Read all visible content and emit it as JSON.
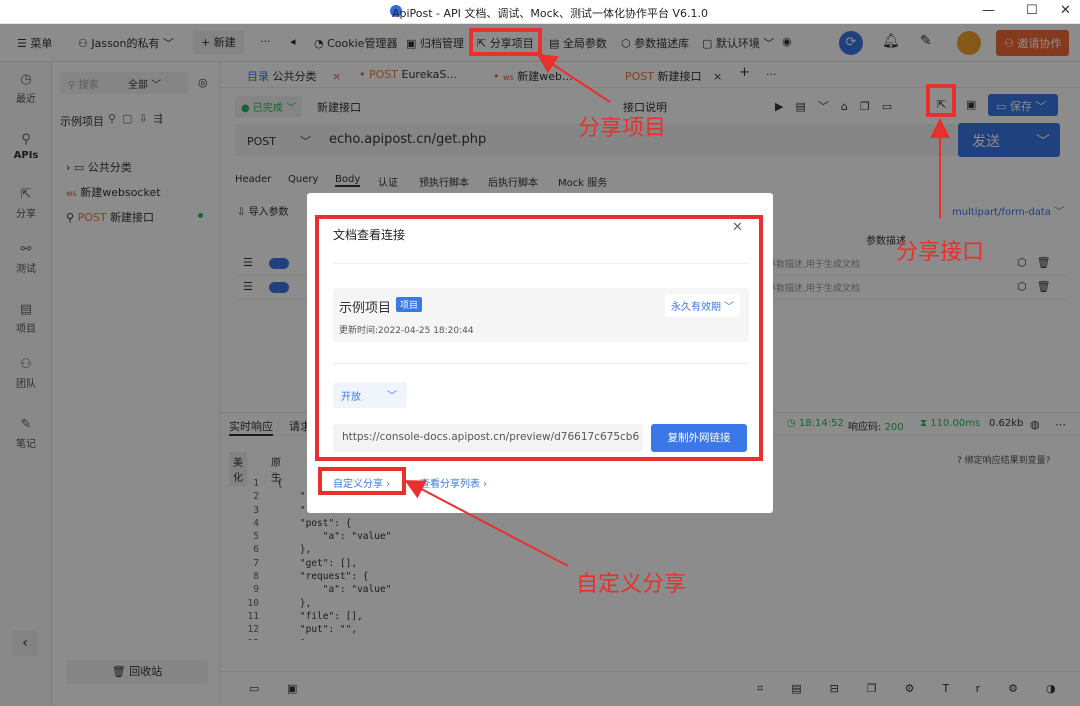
{
  "window": {
    "title": "ApiPost - API 文档、调试、Mock、测试一体化协作平台 V6.1.0"
  },
  "topbar": {
    "menu": "菜单",
    "workspace": "Jasson的私有",
    "new": "新建",
    "more": "···",
    "cookie": "Cookie管理器",
    "archive": "归档管理",
    "share_project": "分享项目",
    "global_params": "全局参数",
    "param_desc": "参数描述库",
    "env": "默认环境",
    "invite": "邀请协作"
  },
  "sidebar": {
    "items": [
      {
        "label": "最近"
      },
      {
        "label": "APIs"
      },
      {
        "label": "分享"
      },
      {
        "label": "测试"
      },
      {
        "label": "项目"
      },
      {
        "label": "团队"
      },
      {
        "label": "笔记"
      }
    ]
  },
  "tree": {
    "search_placeholder": "搜索",
    "filter": "全部",
    "project": "示例项目",
    "items": [
      {
        "label": "公共分类"
      },
      {
        "prefix": "ws",
        "label": "新建websocket"
      },
      {
        "prefix": "POST",
        "label": "新建接口"
      }
    ],
    "recycle": "回收站"
  },
  "tabs": [
    {
      "prefix": "目录",
      "label": "公共分类"
    },
    {
      "prefix": "POST",
      "label": "EurekaS..."
    },
    {
      "prefix": "ws",
      "label": "新建web..."
    },
    {
      "prefix": "POST",
      "label": "新建接口"
    }
  ],
  "request": {
    "status": "已完成",
    "name": "新建接口",
    "desc_label": "接口说明",
    "save": "保存",
    "method": "POST",
    "url": "echo.apipost.cn/get.php",
    "send": "发送"
  },
  "req_tabs": [
    "Header",
    "Query",
    "Body",
    "认证",
    "预执行脚本",
    "后执行脚本",
    "Mock 服务"
  ],
  "body": {
    "import": "导入参数",
    "content_type": "multipart/form-data",
    "param_desc_col": "参数描述",
    "row_hint": "参数描述,用于生成文档"
  },
  "response": {
    "tab_live": "实时响应",
    "tab_req": "请求",
    "beautify": "美化",
    "raw": "原生",
    "time": "18:14:52",
    "code_label": "响应码:",
    "code": "200",
    "duration": "110.00ms",
    "size": "0.62kb",
    "bind": "绑定响应结果到变量?",
    "lines": [
      "{",
      "    \"",
      "    \"",
      "    \"post\": {",
      "        \"a\": \"value\"",
      "    },",
      "    \"get\": [],",
      "    \"request\": {",
      "        \"a\": \"value\"",
      "    },",
      "    \"file\": [],",
      "    \"put\": \"\",",
      "    \""
    ]
  },
  "modal": {
    "title": "文档查看连接",
    "project": "示例项目",
    "badge": "项目",
    "validity": "永久有效期",
    "updated": "更新时间:2022-04-25 18:20:44",
    "access": "开放",
    "link": "https://console-docs.apipost.cn/preview/d76617c675cb6",
    "copy": "复制外网链接",
    "custom": "自定义分享",
    "list": "查看分享列表"
  },
  "annotations": {
    "share_project": "分享项目",
    "share_api": "分享接口",
    "custom_share": "自定义分享"
  },
  "colors": {
    "accent": "#3a78e8",
    "annotation": "#e8302e",
    "invite": "#f26b3a"
  }
}
